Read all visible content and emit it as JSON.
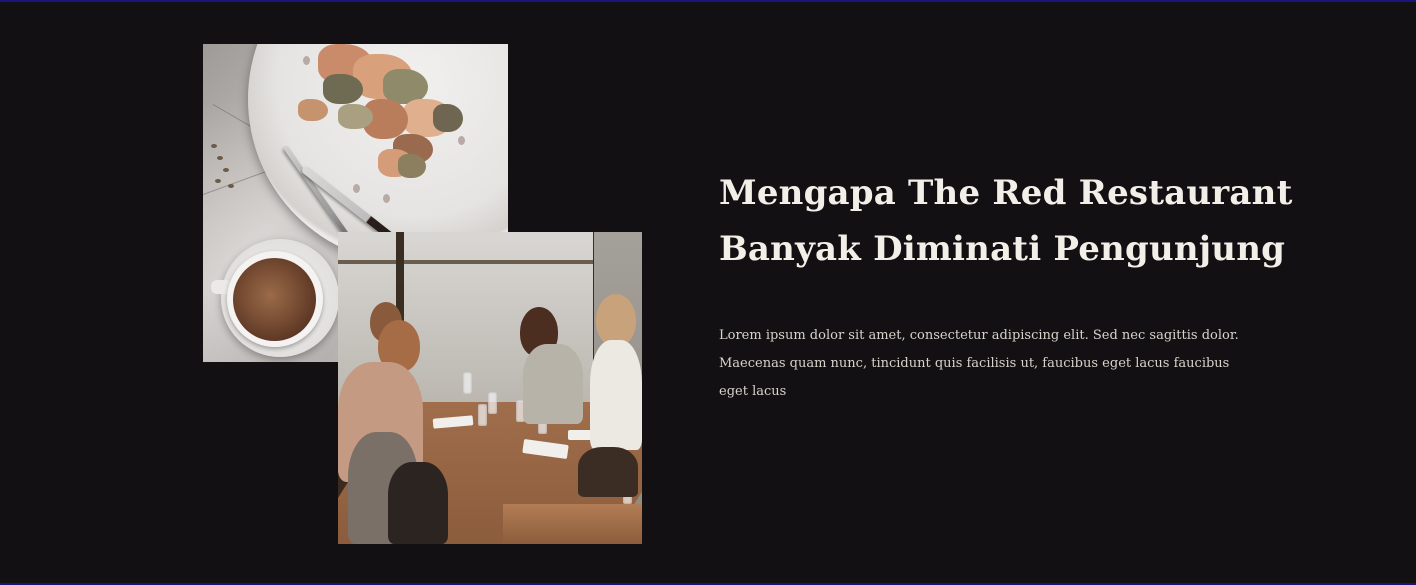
{
  "section": {
    "heading_line1": "Mengapa The Red Restaurant",
    "heading_line2": "Banyak Diminati Pengunjung",
    "paragraph": "Lorem ipsum dolor sit amet, consectetur adipiscing elit. Sed nec sagittis dolor. Maecenas quam nunc, tincidunt quis facilisis ut, faucibus eget lacus faucibus eget lacus"
  },
  "images": {
    "food_photo": "plate-and-coffee-photo",
    "diners_photo": "restaurant-diners-photo"
  },
  "colors": {
    "background": "#121012",
    "heading": "#f2efe9",
    "paragraph": "#d8d3cc",
    "border_accent": "#1a1480"
  }
}
